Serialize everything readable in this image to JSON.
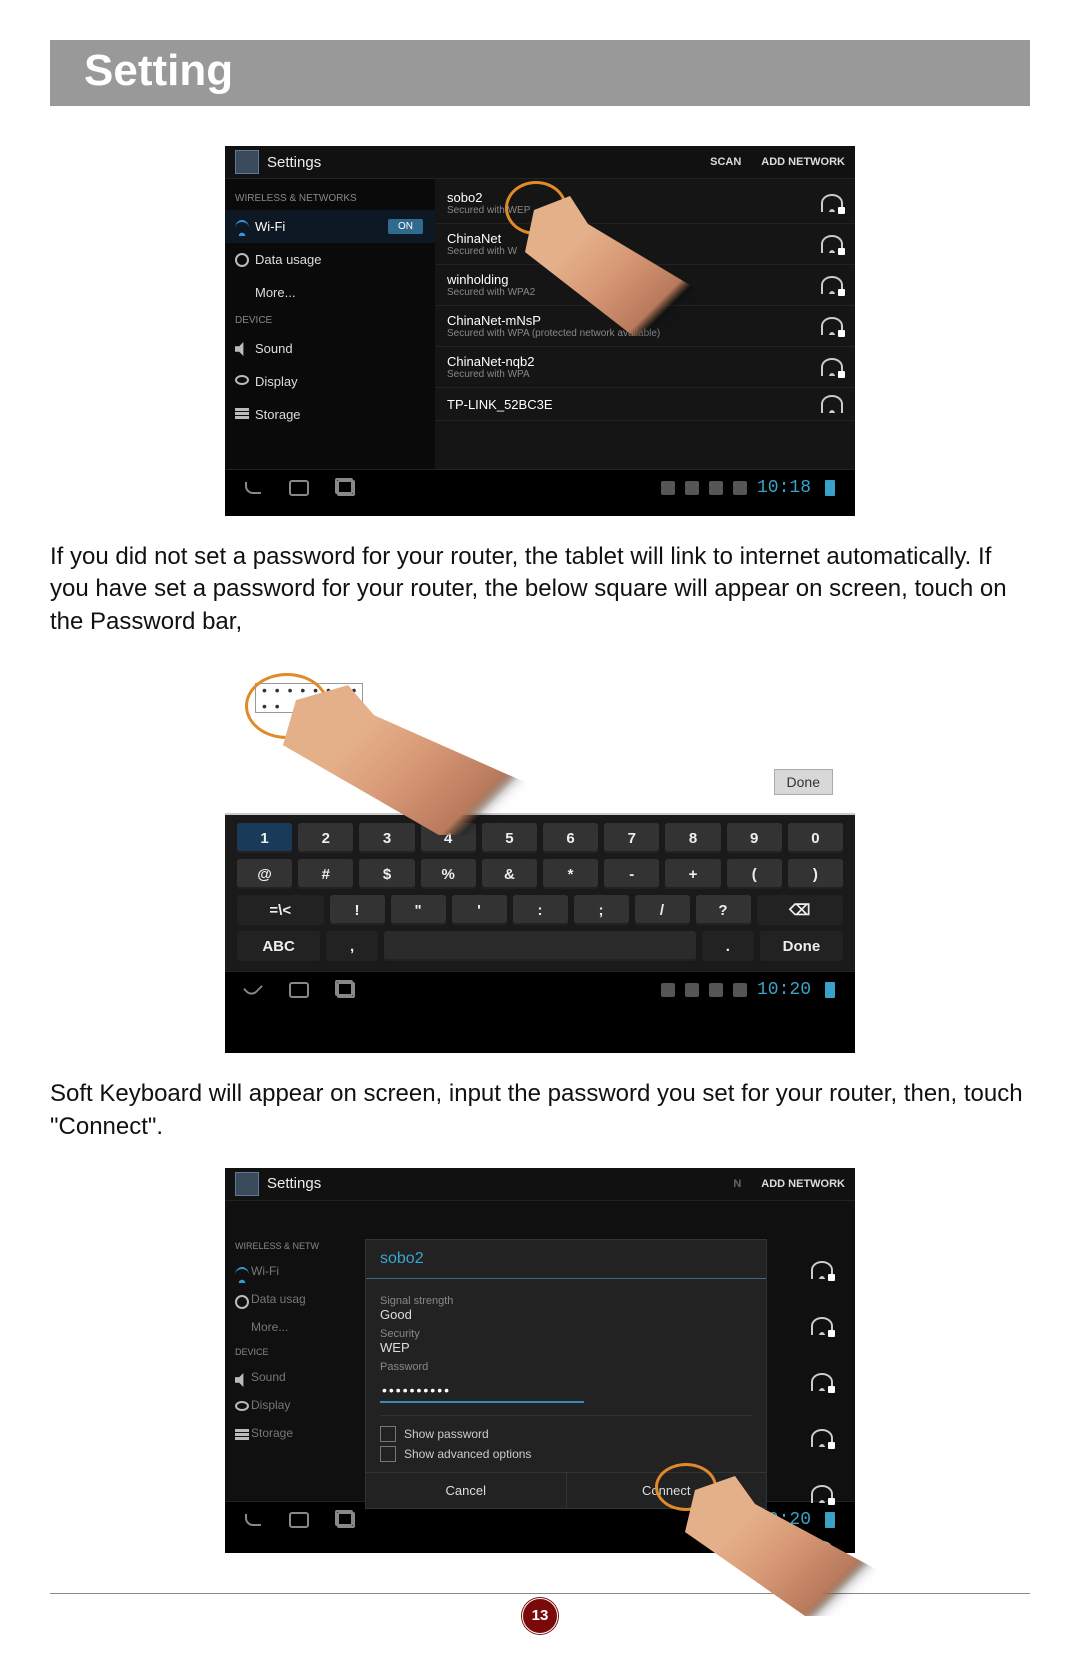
{
  "page": {
    "title": "Setting",
    "number": "13"
  },
  "para1": "If you did not set a password for your router, the tablet will link to internet automatically. If you have set a password for your router, the below square will appear on screen, touch on the Password bar,",
  "para2": "Soft Keyboard will appear on screen, input the password you set for your router, then, touch \"Connect\".",
  "shot1": {
    "header_title": "Settings",
    "action_scan": "SCAN",
    "action_add": "ADD NETWORK",
    "sect_wireless": "WIRELESS & NETWORKS",
    "sect_device": "DEVICE",
    "item_wifi": "Wi-Fi",
    "toggle_on": "ON",
    "item_data": "Data usage",
    "item_more": "More...",
    "item_sound": "Sound",
    "item_display": "Display",
    "item_storage": "Storage",
    "networks": [
      {
        "name": "sobo2",
        "sec": "Secured with WEP"
      },
      {
        "name": "ChinaNet",
        "sec": "Secured with W"
      },
      {
        "name": "winholding",
        "sec": "Secured with WPA2"
      },
      {
        "name": "ChinaNet-mNsP",
        "sec": "Secured with WPA (protected network available)"
      },
      {
        "name": "ChinaNet-nqb2",
        "sec": "Secured with WPA"
      },
      {
        "name": "TP-LINK_52BC3E",
        "sec": ""
      }
    ],
    "clock": "10:18"
  },
  "shot2": {
    "pw_mask": "• • • • • • • • • •",
    "done": "Done",
    "row1": [
      "1",
      "2",
      "3",
      "4",
      "5",
      "6",
      "7",
      "8",
      "9",
      "0"
    ],
    "row2": [
      "@",
      "#",
      "$",
      "%",
      "&",
      "*",
      "-",
      "+",
      "(",
      ")"
    ],
    "row3": [
      "=\\<",
      "!",
      "\"",
      "'",
      ":",
      ";",
      "/",
      "?",
      "⌫"
    ],
    "row4_abc": "ABC",
    "row4_comma": ",",
    "row4_dot": ".",
    "row4_done": "Done",
    "clock": "10:20"
  },
  "shot3": {
    "header_title": "Settings",
    "action_add": "ADD NETWORK",
    "sect_wireless": "WIRELESS & NETW",
    "item_wifi": "Wi-Fi",
    "item_data": "Data usag",
    "item_more": "More...",
    "sect_device": "DEVICE",
    "item_sound": "Sound",
    "item_display": "Display",
    "item_storage": "Storage",
    "dialog": {
      "title": "sobo2",
      "sig_lbl": "Signal strength",
      "sig_val": "Good",
      "sec_lbl": "Security",
      "sec_val": "WEP",
      "pw_lbl": "Password",
      "pw_val": "••••••••••",
      "show_pw": "Show password",
      "show_adv": "Show advanced options",
      "cancel": "Cancel",
      "connect": "Connect"
    },
    "clock": "10:20"
  }
}
